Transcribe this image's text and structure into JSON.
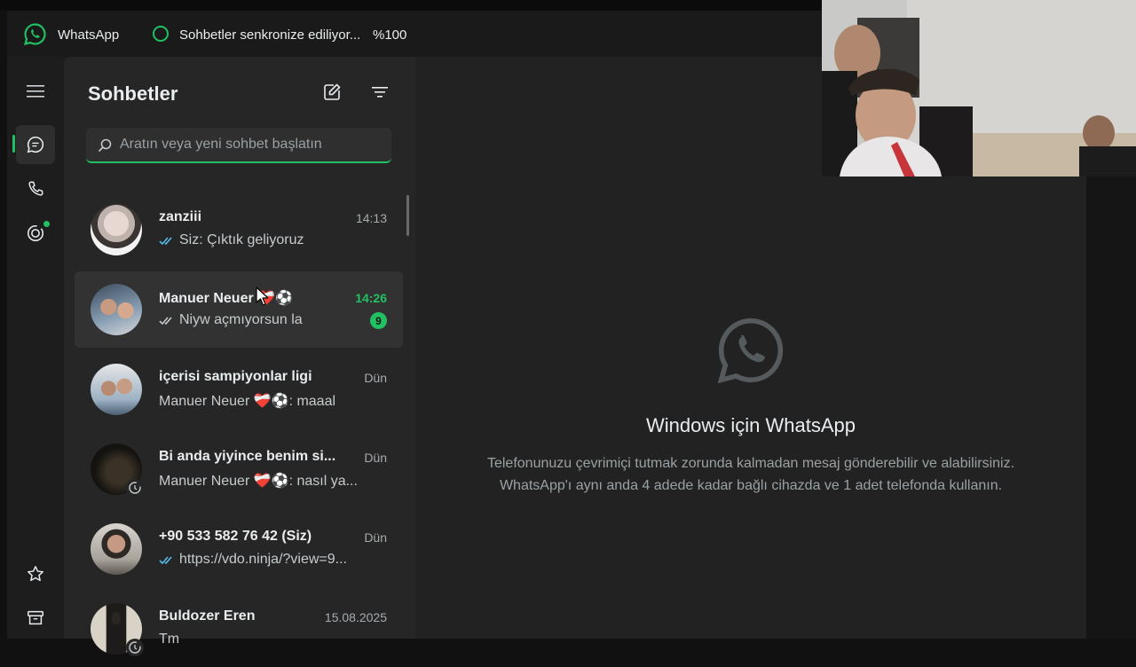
{
  "titlebar": {
    "app_name": "WhatsApp",
    "sync_status": "Sohbetler senkronize ediliyor...",
    "sync_percent": "%100"
  },
  "list": {
    "title": "Sohbetler",
    "search_placeholder": "Aratın veya yeni sohbet başlatın",
    "chats": [
      {
        "name": "zanziii",
        "time": "14:13",
        "preview": "Siz: Çıktık geliyoruz",
        "ticks": "read"
      },
      {
        "name": "Manuer Neuer ❤️‍🩹⚽",
        "time": "14:26",
        "preview": "Niyw açmıyorsun la",
        "ticks": "delivered",
        "unread": "9"
      },
      {
        "name": "içerisi sampiyonlar ligi",
        "time": "Dün",
        "preview": "Manuer Neuer ❤️‍🩹⚽: maaal"
      },
      {
        "name": "Bi anda yiyince benim si...",
        "time": "Dün",
        "preview": "Manuer Neuer ❤️‍🩹⚽: nasıl ya..."
      },
      {
        "name": "+90 533 582 76 42 (Siz)",
        "time": "Dün",
        "preview": "https://vdo.ninja/?view=9...",
        "ticks": "read"
      },
      {
        "name": "Buldozer Eren",
        "time": "15.08.2025",
        "preview": "Tm"
      }
    ]
  },
  "main": {
    "title": "Windows için WhatsApp",
    "desc_line1": "Telefonunuzu çevrimiçi tutmak zorunda kalmadan mesaj gönderebilir ve alabilirsiniz.",
    "desc_line2": "WhatsApp'ı aynı anda 4 adede kadar bağlı cihazda ve 1 adet telefonda kullanın."
  },
  "colors": {
    "accent": "#21c063",
    "read_tick": "#53bdeb",
    "background": "#1d1d1d"
  },
  "icons": [
    "whatsapp-logo-icon",
    "menu-icon",
    "chats-icon",
    "calls-icon",
    "status-icon",
    "starred-icon",
    "archive-icon",
    "new-chat-icon",
    "filter-icon",
    "search-icon"
  ]
}
